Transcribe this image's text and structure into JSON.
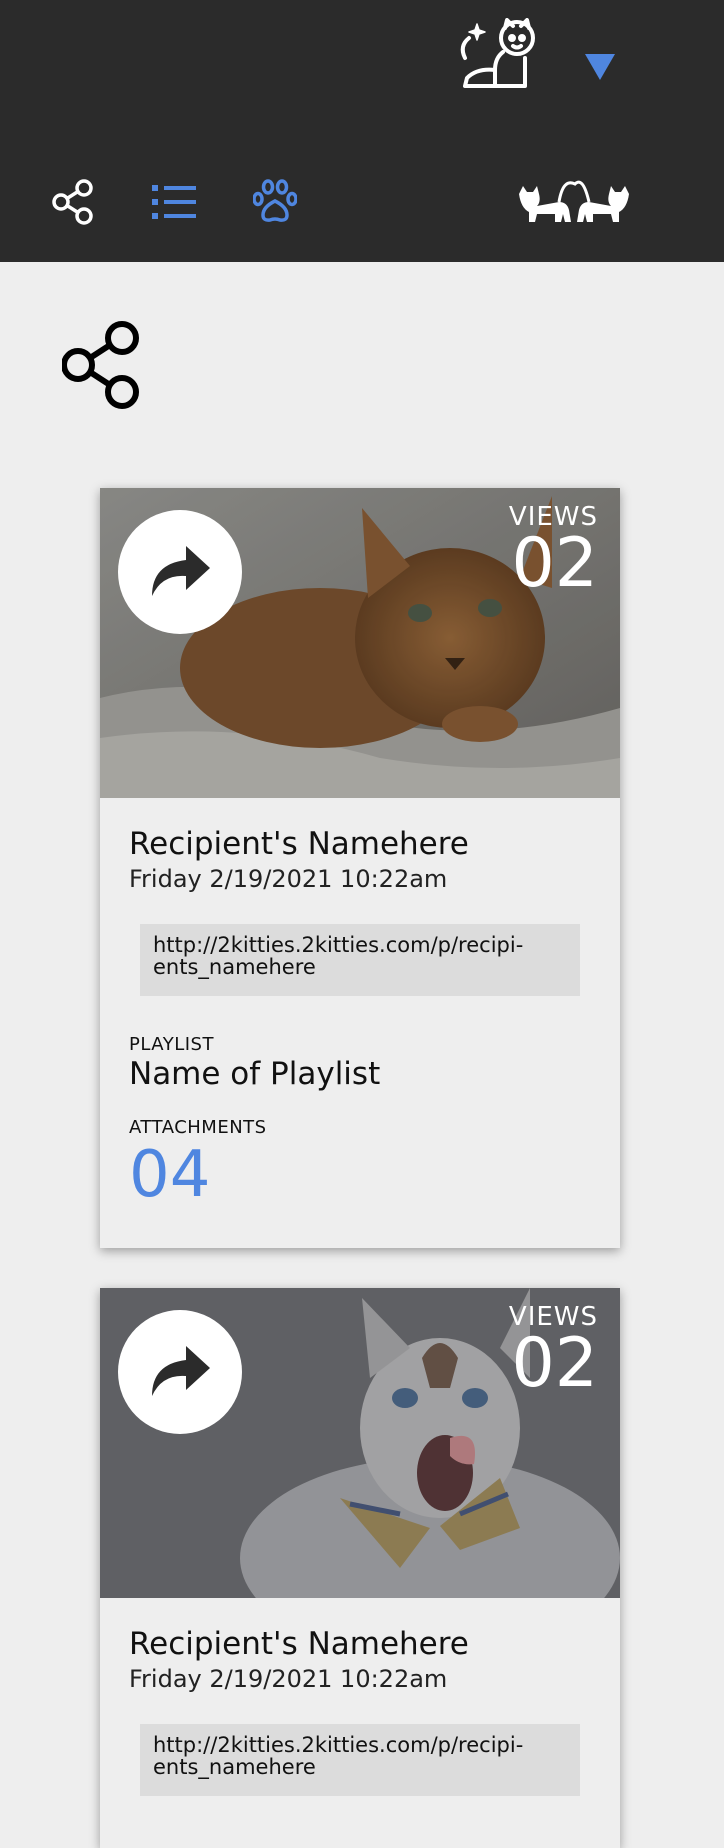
{
  "header": {
    "avatar_icon": "cat-astronaut-icon",
    "dropdown_icon": "triangle-down-icon",
    "nav": [
      {
        "icon": "share-icon",
        "color": "#ffffff"
      },
      {
        "icon": "list-icon",
        "color": "#4f86e0"
      },
      {
        "icon": "paw-icon",
        "color": "#4f86e0"
      }
    ],
    "logo_icon": "two-cats-logo"
  },
  "page": {
    "icon": "share-icon"
  },
  "shares": [
    {
      "views_label": "VIEWS",
      "views_count": "02",
      "recipient": "Recipient's Namehere",
      "date": "Friday 2/19/2021 10:22am",
      "url_line1": "http://2kitties.2kitties.com/p/recipi-",
      "url_line2": "ents_namehere",
      "playlist_label": "PLAYLIST",
      "playlist_name": "Name of Playlist",
      "attachments_label": "ATTACHMENTS",
      "attachments_count": "04"
    },
    {
      "views_label": "VIEWS",
      "views_count": "02",
      "recipient": "Recipient's Namehere",
      "date": "Friday 2/19/2021 10:22am",
      "url_line1": "http://2kitties.2kitties.com/p/recipi-",
      "url_line2": "ents_namehere"
    }
  ],
  "colors": {
    "header_bg": "#2b2b2b",
    "accent": "#4f86e0",
    "page_bg": "#eeeeee"
  }
}
